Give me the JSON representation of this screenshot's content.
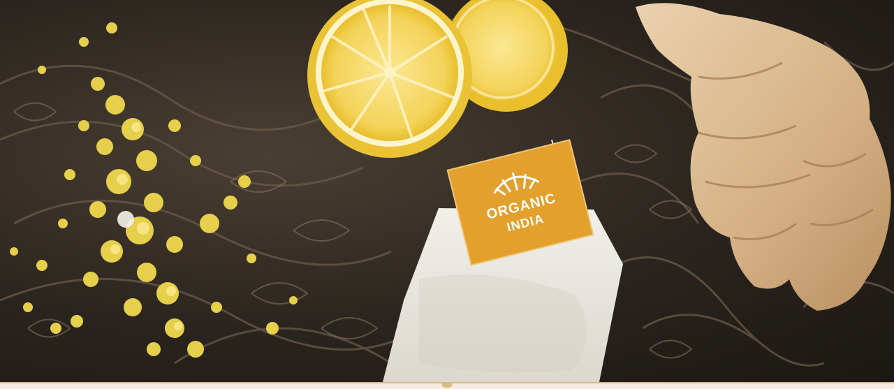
{
  "image": {
    "alt": "",
    "tea_tag": {
      "brand_line_1": "ORGANIC",
      "brand_line_2": "INDIA",
      "icon": "leaf-logo-icon",
      "color": "#e3a02c"
    },
    "colors": {
      "lemon_rind": "#f2cf3c",
      "lemon_flesh": "#f6dc6e",
      "ginger": "#d9b88e",
      "tea_bag": "#e9e6df",
      "zest": "#e6cf4a",
      "plate": "#2a241e"
    }
  }
}
